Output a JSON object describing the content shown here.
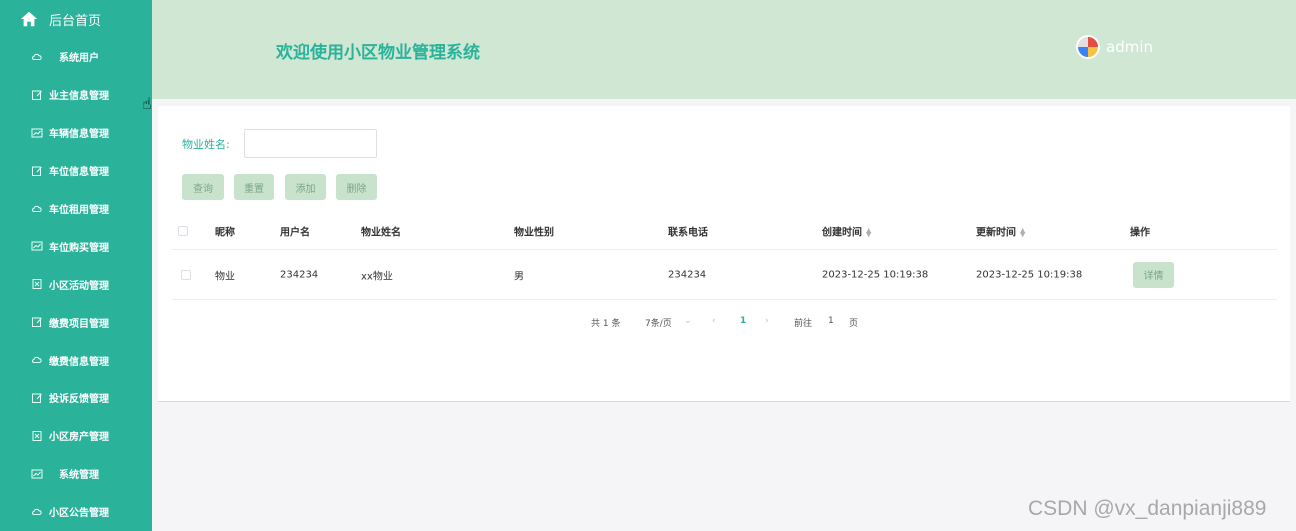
{
  "sidebar": {
    "home_label": "后台首页",
    "items": [
      {
        "label": "系统用户",
        "icon": "cloud-icon"
      },
      {
        "label": "业主信息管理",
        "icon": "edit-icon"
      },
      {
        "label": "车辆信息管理",
        "icon": "chart-icon"
      },
      {
        "label": "车位信息管理",
        "icon": "edit-icon"
      },
      {
        "label": "车位租用管理",
        "icon": "cloud-icon"
      },
      {
        "label": "车位购买管理",
        "icon": "chart-icon"
      },
      {
        "label": "小区活动管理",
        "icon": "doc-icon"
      },
      {
        "label": "缴费项目管理",
        "icon": "edit-icon"
      },
      {
        "label": "缴费信息管理",
        "icon": "cloud-icon"
      },
      {
        "label": "投诉反馈管理",
        "icon": "edit-icon"
      },
      {
        "label": "小区房产管理",
        "icon": "doc-icon"
      },
      {
        "label": "系统管理",
        "icon": "chart-icon"
      },
      {
        "label": "小区公告管理",
        "icon": "cloud-icon"
      }
    ]
  },
  "header": {
    "title": "欢迎使用小区物业管理系统",
    "username": "admin"
  },
  "search": {
    "label": "物业姓名:",
    "value": "",
    "buttons": {
      "query": "查询",
      "reset": "重置",
      "add": "添加",
      "delete": "删除"
    }
  },
  "table": {
    "columns": [
      "昵称",
      "用户名",
      "物业姓名",
      "物业性别",
      "联系电话",
      "创建时间",
      "更新时间",
      "操作"
    ],
    "rows": [
      {
        "nickname": "物业",
        "username": "234234",
        "name": "xx物业",
        "gender": "男",
        "phone": "234234",
        "created": "2023-12-25 10:19:38",
        "updated": "2023-12-25 10:19:38",
        "action": "详情"
      }
    ]
  },
  "pagination": {
    "total": "共 1 条",
    "page_size": "7条/页",
    "current_page": "1",
    "goto_label": "前往",
    "goto_value": "1",
    "page_suffix": "页"
  },
  "watermark": "CSDN @vx_danpianji889",
  "colors": {
    "sidebar": "#2bb29b",
    "header": "#cfe7d3",
    "button": "#c9e2cc"
  }
}
